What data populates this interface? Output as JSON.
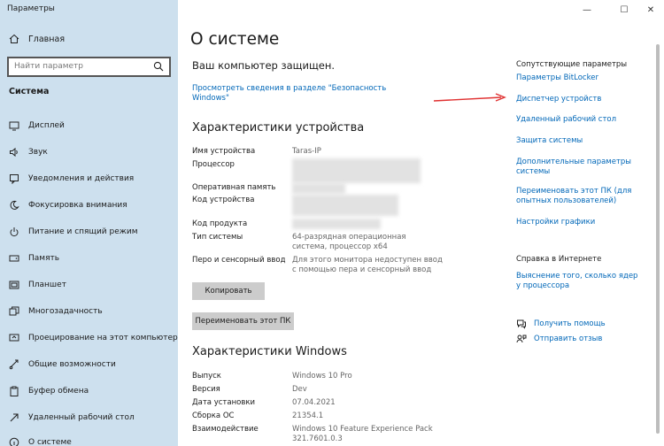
{
  "window": {
    "title": "Параметры",
    "minimize": "—",
    "maximize": "☐",
    "close": "✕"
  },
  "sidebar": {
    "home_label": "Главная",
    "search_placeholder": "Найти параметр",
    "section_label": "Система",
    "items": [
      {
        "label": "Дисплей",
        "icon": "display-icon"
      },
      {
        "label": "Звук",
        "icon": "sound-icon"
      },
      {
        "label": "Уведомления и действия",
        "icon": "notifications-icon"
      },
      {
        "label": "Фокусировка внимания",
        "icon": "focus-moon-icon"
      },
      {
        "label": "Питание и спящий режим",
        "icon": "power-icon"
      },
      {
        "label": "Память",
        "icon": "storage-icon"
      },
      {
        "label": "Планшет",
        "icon": "tablet-icon"
      },
      {
        "label": "Многозадачность",
        "icon": "multitasking-icon"
      },
      {
        "label": "Проецирование на этот компьютер",
        "icon": "projecting-icon"
      },
      {
        "label": "Общие возможности",
        "icon": "shared-experiences-icon"
      },
      {
        "label": "Буфер обмена",
        "icon": "clipboard-icon"
      },
      {
        "label": "Удаленный рабочий стол",
        "icon": "remote-desktop-icon"
      },
      {
        "label": "О системе",
        "icon": "info-icon"
      }
    ]
  },
  "main": {
    "title": "О системе",
    "protected_text": "Ваш компьютер защищен.",
    "security_link": "Просмотреть сведения в разделе \"Безопасность Windows\"",
    "device_specs": {
      "heading": "Характеристики устройства",
      "rows": [
        {
          "label": "Имя устройства",
          "value": "Taras-IP"
        },
        {
          "label": "Процессор",
          "value": ""
        },
        {
          "label": "Оперативная память",
          "value": ""
        },
        {
          "label": "Код устройства",
          "value": ""
        },
        {
          "label": "Код продукта",
          "value": ""
        },
        {
          "label": "Тип системы",
          "value": "64-разрядная операционная система, процессор x64"
        },
        {
          "label": "Перо и сенсорный ввод",
          "value": "Для этого монитора недоступен ввод с помощью пера и сенсорный ввод"
        }
      ],
      "copy_button": "Копировать",
      "rename_button": "Переименовать этот ПК"
    },
    "windows_specs": {
      "heading": "Характеристики Windows",
      "rows": [
        {
          "label": "Выпуск",
          "value": "Windows 10 Pro"
        },
        {
          "label": "Версия",
          "value": "Dev"
        },
        {
          "label": "Дата установки",
          "value": "07.04.2021"
        },
        {
          "label": "Сборка ОС",
          "value": "21354.1"
        },
        {
          "label": "Взаимодействие",
          "value": "Windows 10 Feature Experience Pack 321.7601.0.3"
        }
      ]
    }
  },
  "related": {
    "heading": "Сопутствующие параметры",
    "links": [
      "Параметры BitLocker",
      "Диспетчер устройств",
      "Удаленный рабочий стол",
      "Защита системы",
      "Дополнительные параметры системы",
      "Переименовать этот ПК (для опытных пользователей)",
      "Настройки графики"
    ],
    "help_heading": "Справка в Интернете",
    "help_link": "Выяснение того, сколько ядер у процессора",
    "get_help": "Получить помощь",
    "feedback": "Отправить отзыв"
  },
  "colors": {
    "sidebar_bg": "#cde0ee",
    "link": "#0067b8",
    "button_bg": "#cccccc",
    "arrow": "#e03030"
  }
}
